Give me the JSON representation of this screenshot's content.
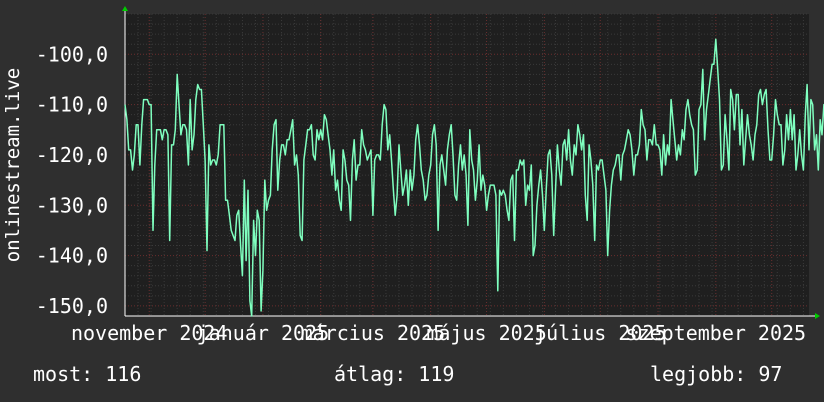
{
  "chart_data": {
    "type": "line",
    "ylabel": "onlinestream.live",
    "ylim": [
      -152,
      -92
    ],
    "y_ticks": [
      "-100,0",
      "-110,0",
      "-120,0",
      "-130,0",
      "-140,0",
      "-150,0"
    ],
    "y_tick_values": [
      -100,
      -110,
      -120,
      -130,
      -140,
      -150
    ],
    "x_range": [
      "2024-10-19",
      "2025-10-21"
    ],
    "x_ticks": [
      "november 2024",
      "január 2025",
      "március 2025",
      "május 2025",
      "július 2025",
      "szeptember 2025"
    ],
    "x_tick_dates": [
      "2024-11-01",
      "2025-01-01",
      "2025-03-01",
      "2025-05-01",
      "2025-07-01",
      "2025-09-01"
    ],
    "grid": true,
    "series": [
      {
        "color": "#7fffbf",
        "x_start": "2024-10-19",
        "x_step_days": 1,
        "values": [
          -110,
          -113,
          -119,
          -119,
          -123,
          -120,
          -114,
          -114,
          -122,
          -114,
          -109,
          -109,
          -109,
          -110,
          -110,
          -135,
          -122,
          -115,
          -115,
          -115,
          -117,
          -115,
          -115,
          -116,
          -137,
          -118,
          -118,
          -115,
          -104,
          -110,
          -116,
          -114,
          -114,
          -115,
          -122,
          -109,
          -119,
          -116,
          -109,
          -106,
          -107,
          -107,
          -114,
          -121,
          -139,
          -118,
          -122,
          -121,
          -121,
          -122,
          -120,
          -114,
          -114,
          -114,
          -129,
          -129,
          -132,
          -135,
          -136,
          -137,
          -132,
          -131,
          -138,
          -144,
          -125,
          -141,
          -127,
          -149,
          -152,
          -133,
          -140,
          -131,
          -133,
          -151,
          -143,
          -125,
          -131,
          -129,
          -128,
          -119,
          -114,
          -113,
          -127,
          -121,
          -118,
          -118,
          -120,
          -117,
          -117,
          -115,
          -113,
          -122,
          -120,
          -124,
          -136,
          -137,
          -121,
          -118,
          -115,
          -115,
          -114,
          -120,
          -121,
          -115,
          -117,
          -115,
          -117,
          -112,
          -113,
          -116,
          -119,
          -124,
          -119,
          -127,
          -125,
          -129,
          -131,
          -119,
          -121,
          -125,
          -126,
          -133,
          -121,
          -117,
          -125,
          -122,
          -122,
          -115,
          -118,
          -119,
          -121,
          -120,
          -119,
          -132,
          -121,
          -120,
          -120,
          -121,
          -114,
          -110,
          -111,
          -119,
          -116,
          -121,
          -127,
          -132,
          -128,
          -118,
          -123,
          -128,
          -126,
          -123,
          -130,
          -123,
          -127,
          -124,
          -117,
          -114,
          -118,
          -123,
          -125,
          -129,
          -128,
          -124,
          -122,
          -116,
          -114,
          -118,
          -135,
          -122,
          -120,
          -123,
          -126,
          -119,
          -116,
          -114,
          -120,
          -128,
          -129,
          -122,
          -118,
          -123,
          -120,
          -124,
          -134,
          -115,
          -121,
          -123,
          -129,
          -125,
          -118,
          -127,
          -124,
          -126,
          -131,
          -128,
          -126,
          -126,
          -126,
          -128,
          -147,
          -127,
          -128,
          -127,
          -128,
          -131,
          -133,
          -125,
          -124,
          -137,
          -123,
          -123,
          -121,
          -122,
          -121,
          -130,
          -126,
          -127,
          -122,
          -140,
          -138,
          -130,
          -126,
          -123,
          -128,
          -135,
          -127,
          -120,
          -119,
          -124,
          -136,
          -127,
          -118,
          -123,
          -126,
          -118,
          -117,
          -121,
          -115,
          -121,
          -124,
          -118,
          -120,
          -114,
          -116,
          -119,
          -116,
          -128,
          -133,
          -118,
          -121,
          -126,
          -137,
          -122,
          -123,
          -121,
          -121,
          -124,
          -127,
          -140,
          -131,
          -126,
          -123,
          -122,
          -120,
          -120,
          -125,
          -120,
          -119,
          -117,
          -115,
          -116,
          -119,
          -124,
          -120,
          -120,
          -118,
          -111,
          -114,
          -115,
          -121,
          -117,
          -117,
          -118,
          -114,
          -118,
          -118,
          -119,
          -124,
          -116,
          -122,
          -118,
          -120,
          -109,
          -113,
          -117,
          -121,
          -118,
          -120,
          -115,
          -117,
          -111,
          -109,
          -112,
          -114,
          -115,
          -124,
          -123,
          -111,
          -110,
          -103,
          -117,
          -111,
          -108,
          -105,
          -102,
          -102,
          -97,
          -103,
          -109,
          -123,
          -122,
          -112,
          -117,
          -123,
          -107,
          -109,
          -115,
          -108,
          -108,
          -118,
          -111,
          -122,
          -117,
          -112,
          -116,
          -118,
          -121,
          -116,
          -114,
          -108,
          -107,
          -110,
          -108,
          -107,
          -115,
          -121,
          -121,
          -116,
          -109,
          -112,
          -114,
          -114,
          -122,
          -119,
          -112,
          -117,
          -111,
          -117,
          -112,
          -123,
          -120,
          -115,
          -120,
          -123,
          -112,
          -106,
          -119,
          -109,
          -110,
          -119,
          -116,
          -123,
          -113,
          -116,
          -110,
          -112,
          -109,
          -110,
          -104,
          -110,
          -123,
          -113,
          -118,
          -104,
          -104,
          -110,
          -108,
          -110,
          -118,
          -116,
          -119,
          -106,
          -116,
          -112,
          -114,
          -119,
          -117,
          -109,
          -117,
          -115,
          -117,
          -110,
          -106,
          -107,
          -111,
          -119,
          -113,
          -115,
          -117,
          -120,
          -122,
          -119,
          -119,
          -115,
          -112,
          -112,
          -110,
          -114,
          -116,
          -116,
          -118,
          -125,
          -121,
          -117,
          -121,
          -125,
          -123,
          -120,
          -116,
          -115,
          -113,
          -119,
          -114,
          -114,
          -118,
          -115,
          -121,
          -128,
          -115,
          -120,
          -116,
          -115,
          -111,
          -107,
          -111,
          -111,
          -106,
          -115,
          -119,
          -118,
          -108,
          -119,
          -116,
          -119,
          -121,
          -119,
          -123,
          -120,
          -122,
          -114,
          -116,
          -119,
          -113,
          -107,
          -116,
          -117,
          -120,
          -113,
          -121,
          -126,
          -125,
          -115,
          -114,
          -107,
          -118,
          -121,
          -118,
          -119,
          -118,
          -115,
          -110,
          -107,
          -106,
          -109,
          -118,
          -118,
          -104,
          -111,
          -112,
          -119,
          -111,
          -115,
          -121,
          -110,
          -105,
          -109,
          -108,
          -115,
          -119,
          -111,
          -103,
          -109,
          -112,
          -118,
          -120,
          -121,
          -116,
          -114,
          -108,
          -113,
          -109,
          -117,
          -120,
          -111,
          -114,
          -107,
          -109,
          -104,
          -111,
          -124,
          -115,
          -115,
          -114,
          -120,
          -116,
          -116
        ]
      }
    ]
  },
  "stats": {
    "current_label": "most:",
    "current_value": "116",
    "average_label": "átlag:",
    "average_value": "119",
    "best_label": "legjobb:",
    "best_value": "97"
  },
  "colors": {
    "background": "#2f2f2f",
    "plot_background": "#1f1f1f",
    "line": "#7fffbf",
    "grid_minor": "#3a3a3a",
    "grid_major": "#6b2f2f",
    "axis_arrow": "#00cc00"
  }
}
